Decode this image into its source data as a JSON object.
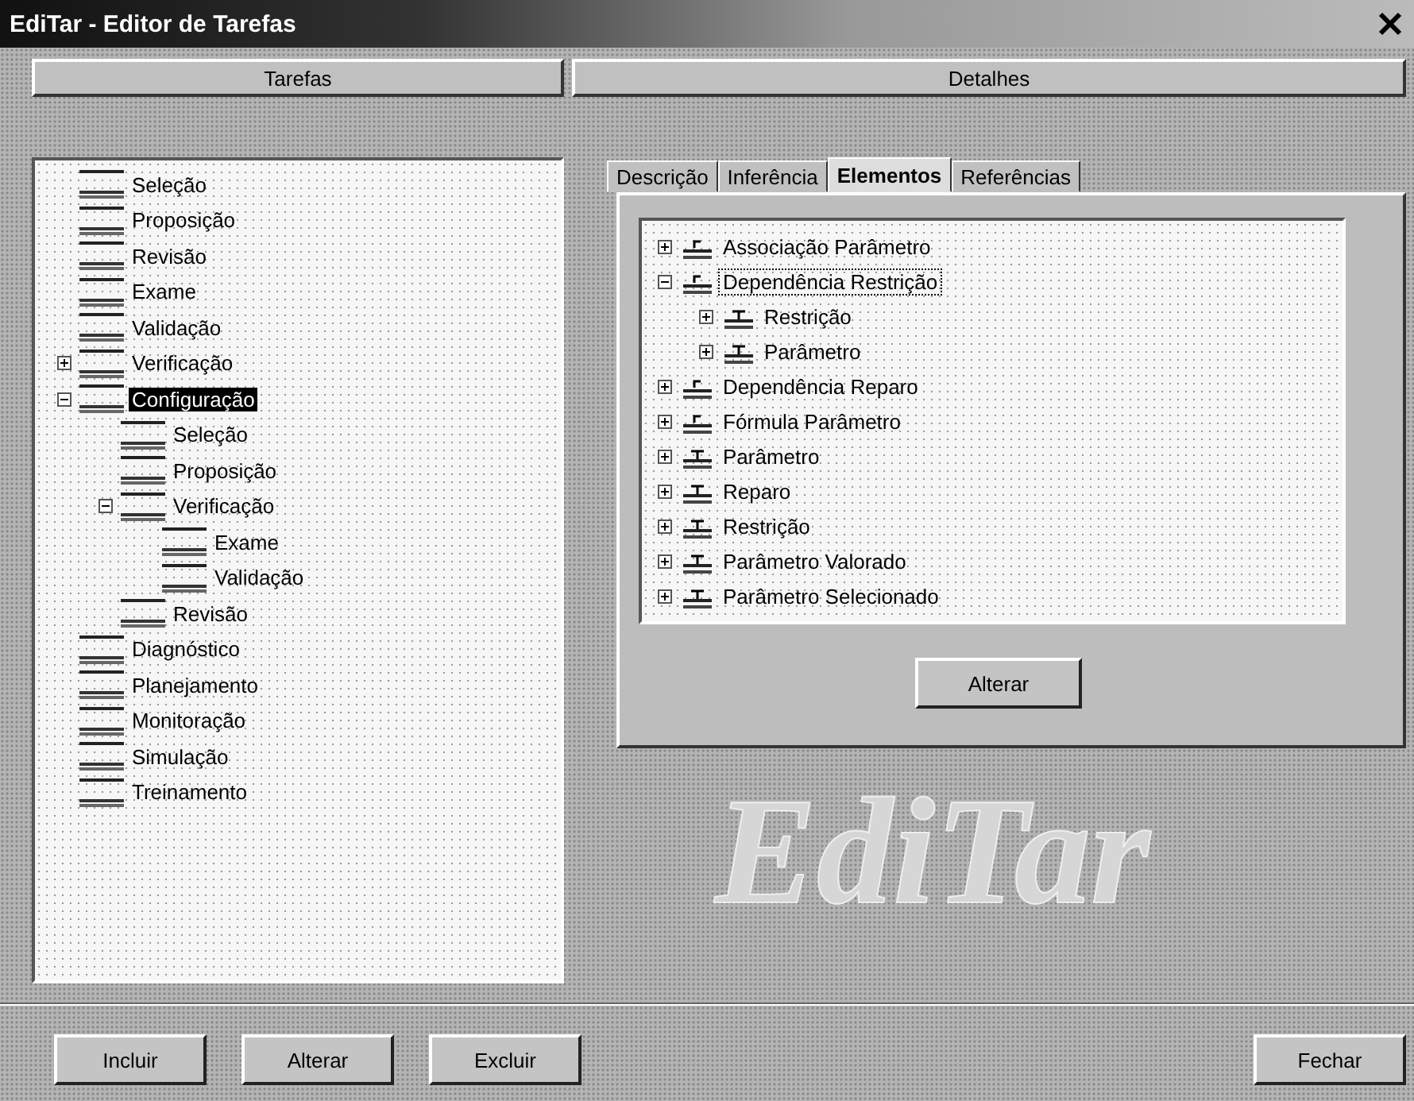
{
  "window": {
    "title": "EdiTar - Editor de Tarefas"
  },
  "left_panel": {
    "header": "Tarefas",
    "tree": [
      {
        "label": "Seleção",
        "selected": false
      },
      {
        "label": "Proposição",
        "selected": false
      },
      {
        "label": "Revisão",
        "selected": false
      },
      {
        "label": "Exame",
        "selected": false
      },
      {
        "label": "Validação",
        "selected": false
      },
      {
        "label": "Verificação",
        "selected": false,
        "expanded": false
      },
      {
        "label": "Configuração",
        "selected": true,
        "expanded": true,
        "children": [
          {
            "label": "Seleção",
            "selected": false
          },
          {
            "label": "Proposição",
            "selected": false
          },
          {
            "label": "Verificação",
            "selected": false,
            "expanded": true,
            "children": [
              {
                "label": "Exame",
                "selected": false
              },
              {
                "label": "Validação",
                "selected": false
              }
            ]
          },
          {
            "label": "Revisão",
            "selected": false
          }
        ]
      },
      {
        "label": "Diagnóstico",
        "selected": false
      },
      {
        "label": "Planejamento",
        "selected": false
      },
      {
        "label": "Monitoração",
        "selected": false
      },
      {
        "label": "Simulação",
        "selected": false
      },
      {
        "label": "Treinamento",
        "selected": false
      }
    ]
  },
  "right_panel": {
    "header": "Detalhes",
    "tabs": [
      {
        "label": "Descrição",
        "selected": false
      },
      {
        "label": "Inferência",
        "selected": false
      },
      {
        "label": "Elementos",
        "selected": true
      },
      {
        "label": "Referências",
        "selected": false
      }
    ],
    "tree": [
      {
        "label": "Associação Parâmetro",
        "kind": "composite",
        "selected": false,
        "expanded": false
      },
      {
        "label": "Dependência Restrição",
        "kind": "composite",
        "selected": true,
        "expanded": true,
        "children": [
          {
            "label": "Restrição",
            "kind": "simple",
            "selected": false,
            "expanded": false
          },
          {
            "label": "Parâmetro",
            "kind": "simple",
            "selected": false,
            "expanded": false
          }
        ]
      },
      {
        "label": "Dependência Reparo",
        "kind": "composite",
        "selected": false,
        "expanded": false
      },
      {
        "label": "Fórmula Parâmetro",
        "kind": "composite",
        "selected": false,
        "expanded": false
      },
      {
        "label": "Parâmetro",
        "kind": "simple",
        "selected": false,
        "expanded": false
      },
      {
        "label": "Reparo",
        "kind": "simple",
        "selected": false,
        "expanded": false
      },
      {
        "label": "Restrição",
        "kind": "simple",
        "selected": false,
        "expanded": false
      },
      {
        "label": "Parâmetro Valorado",
        "kind": "simple",
        "selected": false,
        "expanded": false
      },
      {
        "label": "Parâmetro Selecionado",
        "kind": "simple",
        "selected": false,
        "expanded": false
      }
    ],
    "button": "Alterar"
  },
  "logo": "EdiTar",
  "buttons": [
    {
      "label": "Incluir"
    },
    {
      "label": "Alterar"
    },
    {
      "label": "Excluir"
    }
  ],
  "close_button": "Fechar"
}
